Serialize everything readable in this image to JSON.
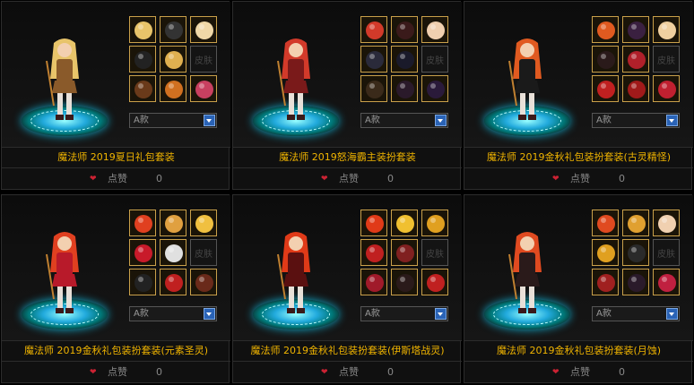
{
  "colors": {
    "title_gold": "#f0b400",
    "slot_border": "#c9a04a",
    "platform_cyan": "#22aadd",
    "select_arrow_blue": "#2a63b6"
  },
  "cards": [
    {
      "title": "魔法师 2019夏日礼包套装",
      "variant": "A款",
      "like_label": "点赞",
      "like_count": "0",
      "hair": "#e8c46a",
      "outfit": "#8a5a2a",
      "empty_slot_label": "皮肤"
    },
    {
      "title": "魔法师 2019怒海霸主装扮套装",
      "variant": "A款",
      "like_label": "点赞",
      "like_count": "0",
      "hair": "#d23a2a",
      "outfit": "#7a1a1a",
      "empty_slot_label": "皮肤"
    },
    {
      "title": "魔法师 2019金秋礼包装扮套装(古灵精怪)",
      "variant": "A款",
      "like_label": "点赞",
      "like_count": "0",
      "hair": "#e05a20",
      "outfit": "#1a1a1a",
      "empty_slot_label": "皮肤"
    },
    {
      "title": "魔法师 2019金秋礼包装扮套装(元素圣灵)",
      "variant": "A款",
      "like_label": "点赞",
      "like_count": "0",
      "hair": "#e04020",
      "outfit": "#b81a2a",
      "empty_slot_label": "皮肤"
    },
    {
      "title": "魔法师 2019金秋礼包装扮套装(伊斯塔战灵)",
      "variant": "A款",
      "like_label": "点赞",
      "like_count": "0",
      "hair": "#e03a18",
      "outfit": "#5a1010",
      "empty_slot_label": "皮肤"
    },
    {
      "title": "魔法师 2019金秋礼包装扮套装(月蚀)",
      "variant": "A款",
      "like_label": "点赞",
      "like_count": "0",
      "hair": "#e04a20",
      "outfit": "#2a1a1a",
      "empty_slot_label": "皮肤"
    }
  ]
}
